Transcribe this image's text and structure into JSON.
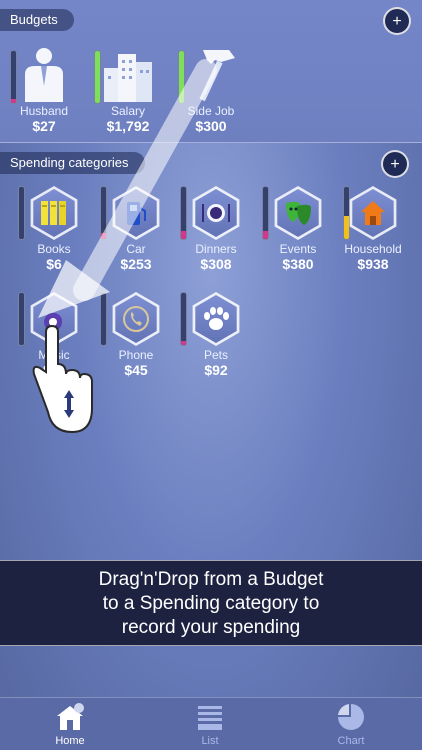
{
  "budgets": {
    "title": "Budgets",
    "add_label": "+",
    "items": [
      {
        "name": "Husband",
        "amount": "$27",
        "icon": "person-icon",
        "level": 0.05,
        "color": "#d03a8c"
      },
      {
        "name": "Salary",
        "amount": "$1,792",
        "icon": "buildings-icon",
        "level": 1.0,
        "color": "#7ee05a"
      },
      {
        "name": "Side Job",
        "amount": "$300",
        "icon": "hammer-icon",
        "level": 1.0,
        "color": "#7ee05a"
      }
    ]
  },
  "spending": {
    "title": "Spending categories",
    "add_label": "+",
    "items": [
      {
        "name": "Books",
        "amount": "$6",
        "icon": "books-icon",
        "level": 0.0,
        "color": "#d03a8c"
      },
      {
        "name": "Car",
        "amount": "$253",
        "icon": "fuel-pump-icon",
        "level": 0.12,
        "color": "#d03a8c"
      },
      {
        "name": "Dinners",
        "amount": "$308",
        "icon": "plate-cutlery-icon",
        "level": 0.15,
        "color": "#d03a8c"
      },
      {
        "name": "Events",
        "amount": "$380",
        "icon": "theater-masks-icon",
        "level": 0.15,
        "color": "#d03a8c"
      },
      {
        "name": "Household",
        "amount": "$938",
        "icon": "house-icon",
        "level": 0.45,
        "color": "#f0c020"
      },
      {
        "name": "Music",
        "amount": "$…",
        "icon": "music-icon",
        "level": 0.0,
        "color": "#d03a8c"
      },
      {
        "name": "Phone",
        "amount": "$45",
        "icon": "phone-icon",
        "level": 0.0,
        "color": "#d03a8c"
      },
      {
        "name": "Pets",
        "amount": "$92",
        "icon": "paw-icon",
        "level": 0.05,
        "color": "#d03a8c"
      }
    ]
  },
  "banner": {
    "line1": "Drag'n'Drop from a Budget",
    "line2": "to a Spending category to",
    "line3": "record your spending"
  },
  "tabs": [
    {
      "label": "Home",
      "icon": "home-icon",
      "active": true
    },
    {
      "label": "List",
      "icon": "list-icon",
      "active": false
    },
    {
      "label": "Chart",
      "icon": "pie-chart-icon",
      "active": false
    }
  ]
}
